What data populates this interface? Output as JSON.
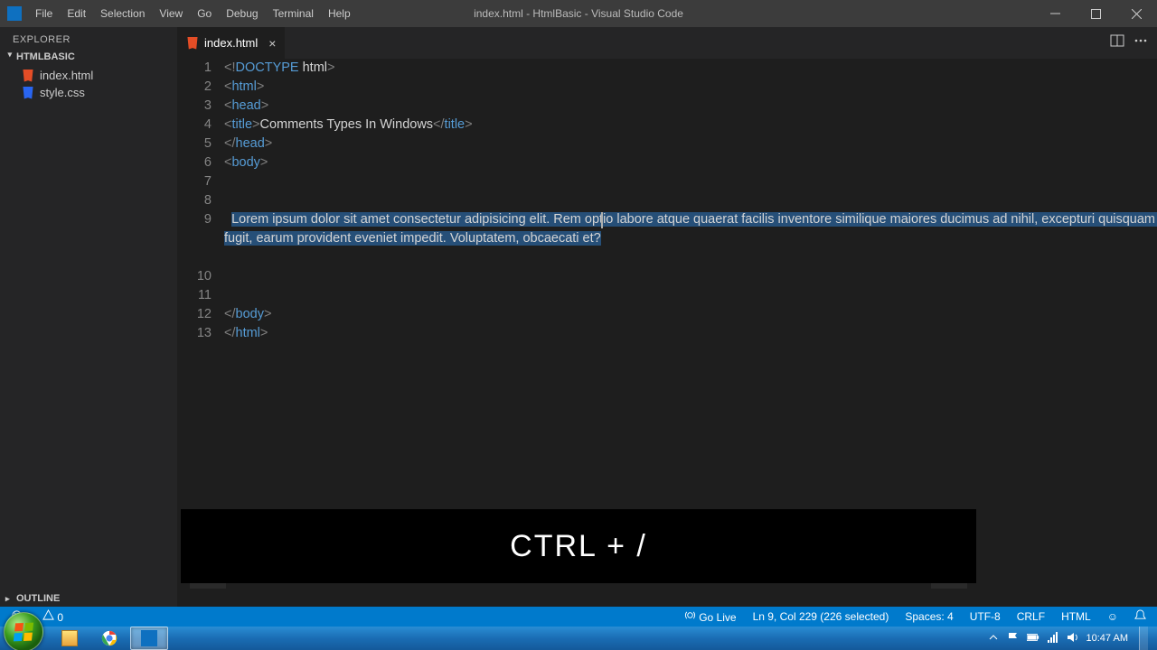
{
  "window": {
    "title": "index.html - HtmlBasic - Visual Studio Code"
  },
  "menu": [
    "File",
    "Edit",
    "Selection",
    "View",
    "Go",
    "Debug",
    "Terminal",
    "Help"
  ],
  "explorer": {
    "title": "EXPLORER",
    "folder": "HTMLBASIC",
    "files": [
      {
        "name": "index.html",
        "kind": "html"
      },
      {
        "name": "style.css",
        "kind": "css"
      }
    ],
    "outline": "OUTLINE"
  },
  "tabs": {
    "active": "index.html"
  },
  "editor": {
    "lines": [
      {
        "n": "1",
        "tokens": [
          [
            "punct",
            "<!"
          ],
          [
            "doctype",
            "DOCTYPE"
          ],
          [
            "kw",
            " html"
          ],
          [
            "punct",
            ">"
          ]
        ]
      },
      {
        "n": "2",
        "tokens": [
          [
            "punct",
            "<"
          ],
          [
            "tag",
            "html"
          ],
          [
            "punct",
            ">"
          ]
        ]
      },
      {
        "n": "3",
        "tokens": [
          [
            "punct",
            "<"
          ],
          [
            "tag",
            "head"
          ],
          [
            "punct",
            ">"
          ]
        ]
      },
      {
        "n": "4",
        "tokens": [
          [
            "punct",
            "<"
          ],
          [
            "tag",
            "title"
          ],
          [
            "punct",
            ">"
          ],
          [
            "text",
            "Comments Types In Windows"
          ],
          [
            "punct",
            "</"
          ],
          [
            "tag",
            "title"
          ],
          [
            "punct",
            ">"
          ]
        ]
      },
      {
        "n": "5",
        "tokens": [
          [
            "punct",
            "</"
          ],
          [
            "tag",
            "head"
          ],
          [
            "punct",
            ">"
          ]
        ]
      },
      {
        "n": "6",
        "tokens": [
          [
            "punct",
            "<"
          ],
          [
            "tag",
            "body"
          ],
          [
            "punct",
            ">"
          ]
        ]
      },
      {
        "n": "7",
        "tokens": []
      },
      {
        "n": "8",
        "tokens": []
      },
      {
        "n": "9",
        "wrap": true,
        "indent": "  ",
        "selected": true,
        "text": "Lorem ipsum dolor sit amet consectetur adipisicing elit. Rem optio labore atque quaerat facilis inventore similique maiores ducimus ad nihil, excepturi quisquam fugit, earum provident eveniet impedit. Voluptatem, obcaecati et?"
      },
      {
        "n": "10",
        "tokens": []
      },
      {
        "n": "11",
        "tokens": []
      },
      {
        "n": "12",
        "tokens": [
          [
            "punct",
            "</"
          ],
          [
            "tag",
            "body"
          ],
          [
            "punct",
            ">"
          ]
        ]
      },
      {
        "n": "13",
        "tokens": [
          [
            "punct",
            "</"
          ],
          [
            "tag",
            "html"
          ],
          [
            "punct",
            ">"
          ]
        ]
      }
    ]
  },
  "overlay": {
    "keys": "CTRL + /"
  },
  "status": {
    "errors": "0",
    "warnings": "0",
    "golive": "Go Live",
    "position": "Ln 9, Col 229 (226 selected)",
    "spaces": "Spaces: 4",
    "encoding": "UTF-8",
    "eol": "CRLF",
    "lang": "HTML",
    "feedback": "☺"
  },
  "taskbar": {
    "time": "10:47 AM"
  }
}
